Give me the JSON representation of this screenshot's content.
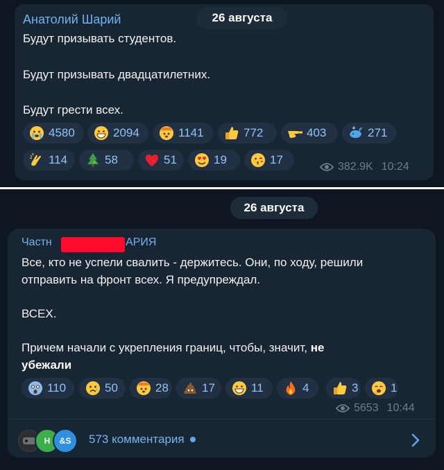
{
  "post1": {
    "author": "Анатолий Шарий",
    "date": "26 августа",
    "lines": [
      "Будут призывать студентов.",
      "Будут призывать двадцатилетних.",
      "Будут грести всех."
    ],
    "reactions": [
      {
        "icon": "crying-face-icon",
        "count": "4580"
      },
      {
        "icon": "grinning-face-icon",
        "count": "2094"
      },
      {
        "icon": "exploding-head-icon",
        "count": "1141"
      },
      {
        "icon": "thumbs-up-icon",
        "count": "772"
      },
      {
        "icon": "pointing-hand-icon",
        "count": "403"
      },
      {
        "icon": "whale-icon",
        "count": "271"
      },
      {
        "icon": "clapping-hands-icon",
        "count": "114"
      },
      {
        "icon": "christmas-tree-icon",
        "count": "58"
      },
      {
        "icon": "red-heart-icon",
        "count": "51"
      },
      {
        "icon": "heart-eyes-icon",
        "count": "19"
      },
      {
        "icon": "kissing-face-icon",
        "count": "17"
      }
    ],
    "views": "382.9K",
    "time": "10:24"
  },
  "date_separator": "26 августа",
  "post2": {
    "author_start": "Частн",
    "author_end": "АРИЯ",
    "lines": [
      "Все, кто не успели свалить - держитесь. Они, по ходу, решили",
      "отправить на фронт всех. Я предупреждал.",
      "ВСЕХ.",
      "Причем начали с укрепления границ, чтобы, значит,"
    ],
    "bold_tail": "не",
    "bold_line": "убежали",
    "reactions": [
      {
        "icon": "screaming-face-icon",
        "count": "110"
      },
      {
        "icon": "sad-face-icon",
        "count": "50"
      },
      {
        "icon": "exploding-head-icon",
        "count": "28"
      },
      {
        "icon": "poop-icon",
        "count": "17"
      },
      {
        "icon": "grinning-face-icon",
        "count": "11"
      },
      {
        "icon": "fire-icon",
        "count": "4"
      },
      {
        "icon": "thumbs-up-icon",
        "count": "3"
      },
      {
        "icon": "yawning-face-icon",
        "count": "1"
      }
    ],
    "views": "5653",
    "time": "10:44"
  },
  "comments": {
    "avatars": [
      "",
      "Н",
      "&S"
    ],
    "label": "573 комментария"
  }
}
